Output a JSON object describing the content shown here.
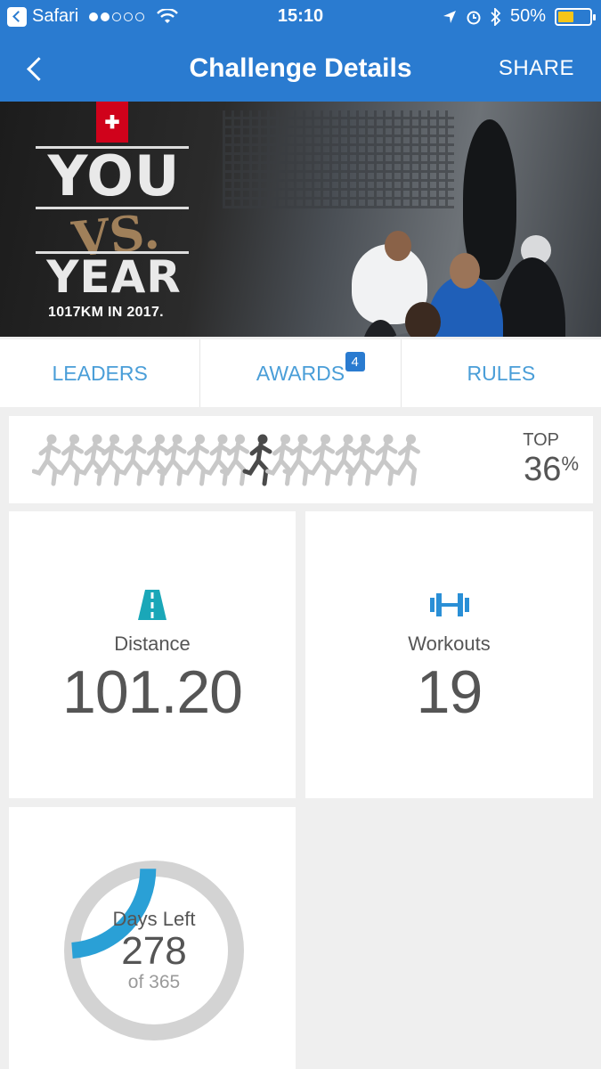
{
  "status_bar": {
    "app": "Safari",
    "time": "15:10",
    "battery": "50%"
  },
  "nav": {
    "title": "Challenge Details",
    "share": "SHARE"
  },
  "banner": {
    "headline_top": "YOU",
    "headline_mid": "VS.",
    "headline_bottom": "YEAR",
    "caption": "1017KM IN 2017."
  },
  "tabs": [
    {
      "label": "LEADERS"
    },
    {
      "label": "AWARDS",
      "badge": "4"
    },
    {
      "label": "RULES"
    }
  ],
  "percentile": {
    "label": "TOP",
    "value": "36",
    "unit": "%"
  },
  "stats": {
    "distance": {
      "label": "Distance",
      "value": "101.20"
    },
    "workouts": {
      "label": "Workouts",
      "value": "19"
    }
  },
  "days": {
    "label": "Days Left",
    "value": "278",
    "of": "of 365",
    "remaining_fraction": 0.7616
  },
  "colors": {
    "brand_blue": "#2a7bd0",
    "tab_blue": "#4a9ed8",
    "distance_teal": "#1aa7b8",
    "ring_blue": "#2aa0d6",
    "ring_grey": "#d3d3d3"
  }
}
